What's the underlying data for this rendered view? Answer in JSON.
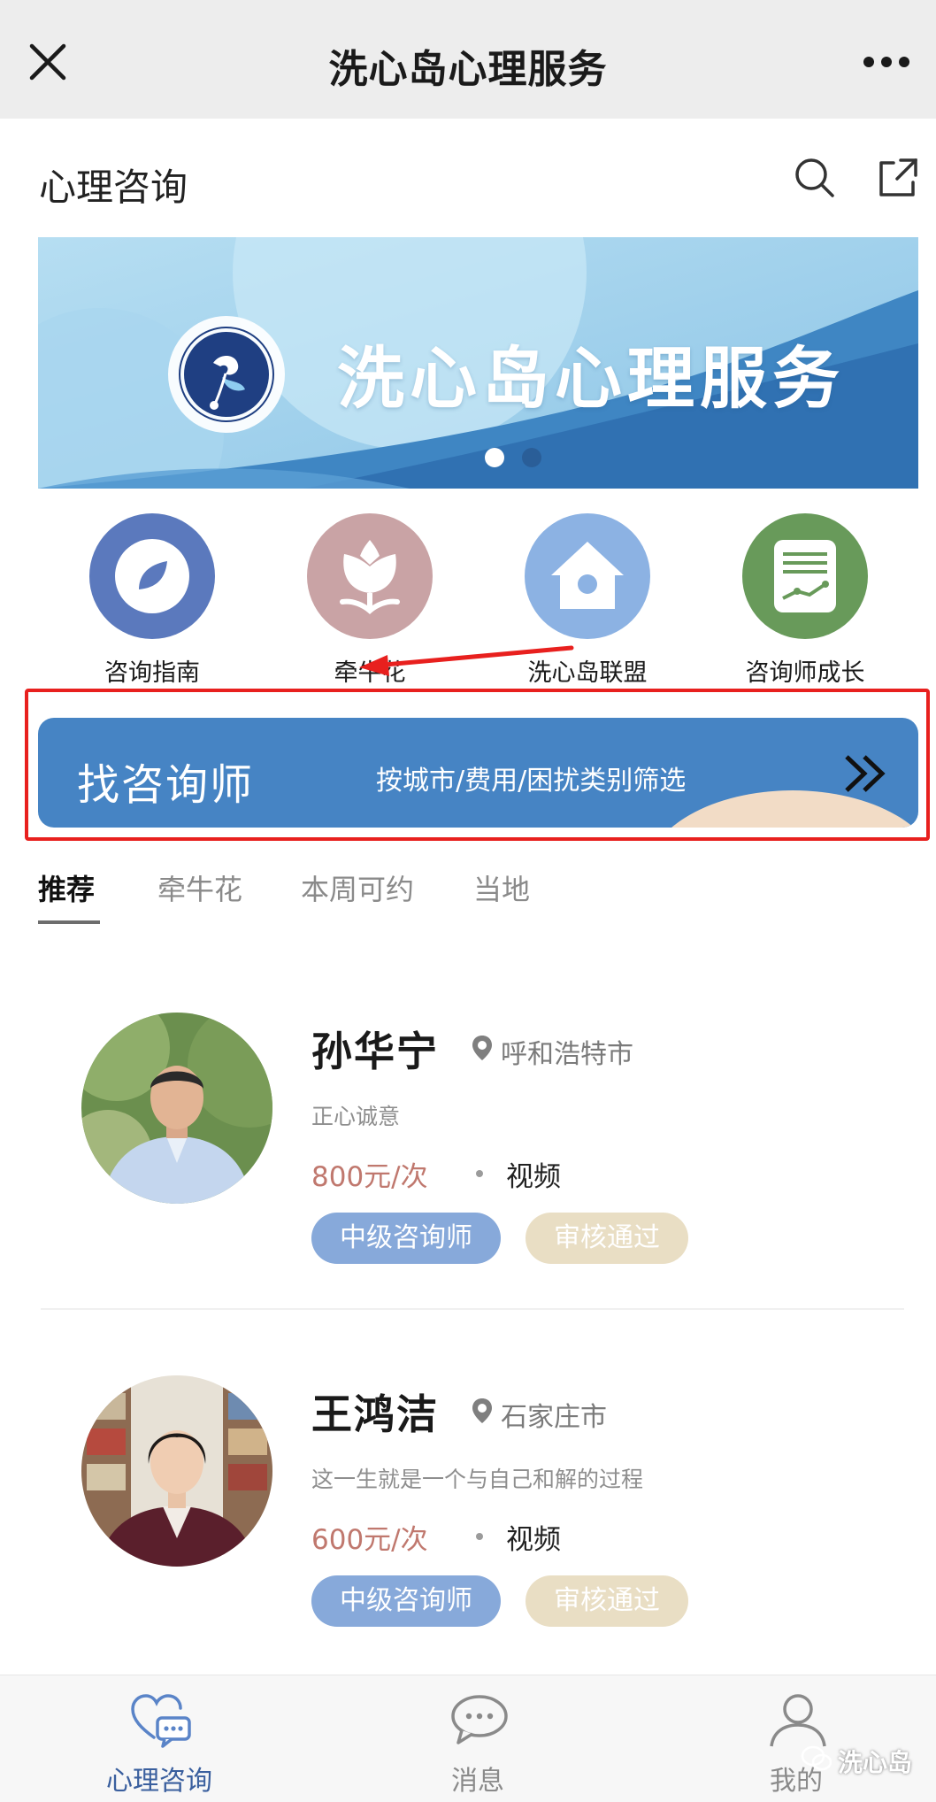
{
  "window": {
    "title": "洗心岛心理服务",
    "close_icon": "close-icon",
    "more_icon": "more-icon"
  },
  "header": {
    "title": "心理咨询",
    "search_icon": "search-icon",
    "share_icon": "share-icon"
  },
  "banner": {
    "logo_icon": "xinxindao-logo",
    "title": "洗心岛心理服务",
    "active_slide": 1,
    "slide_count": 2
  },
  "quick_links": [
    {
      "label": "咨询指南",
      "icon": "compass-icon",
      "color": "#5b79bd"
    },
    {
      "label": "牵牛花",
      "icon": "flower-icon",
      "color": "#c9a3a5"
    },
    {
      "label": "洗心岛联盟",
      "icon": "home-icon",
      "color": "#8cb2e3"
    },
    {
      "label": "咨询师成长",
      "icon": "growth-chart-icon",
      "color": "#689a5a"
    }
  ],
  "finder": {
    "title": "找咨询师",
    "subtitle": "按城市/费用/困扰类别筛选",
    "arrow_icon": "double-chevron-right-icon"
  },
  "tabs": [
    {
      "label": "推荐",
      "active": true
    },
    {
      "label": "牵牛花",
      "active": false
    },
    {
      "label": "本周可约",
      "active": false
    },
    {
      "label": "当地",
      "active": false
    }
  ],
  "counselors": [
    {
      "name": "孙华宁",
      "city": "呼和浩特市",
      "motto": "正心诚意",
      "price": "800元/次",
      "mode": "视频",
      "level": "中级咨询师",
      "status": "审核通过"
    },
    {
      "name": "王鸿洁",
      "city": "石家庄市",
      "motto": "这一生就是一个与自己和解的过程",
      "price": "600元/次",
      "mode": "视频",
      "level": "中级咨询师",
      "status": "审核通过"
    }
  ],
  "bottom_nav": [
    {
      "label": "心理咨询",
      "icon": "chat-heart-icon",
      "active": true
    },
    {
      "label": "消息",
      "icon": "message-icon",
      "active": false
    },
    {
      "label": "我的",
      "icon": "user-icon",
      "active": false
    }
  ],
  "watermark": "洗心岛",
  "colors": {
    "accent_blue": "#4684c4",
    "active_nav": "#5a84c8",
    "annotation_red": "#e8201e",
    "price": "#c0786e"
  }
}
